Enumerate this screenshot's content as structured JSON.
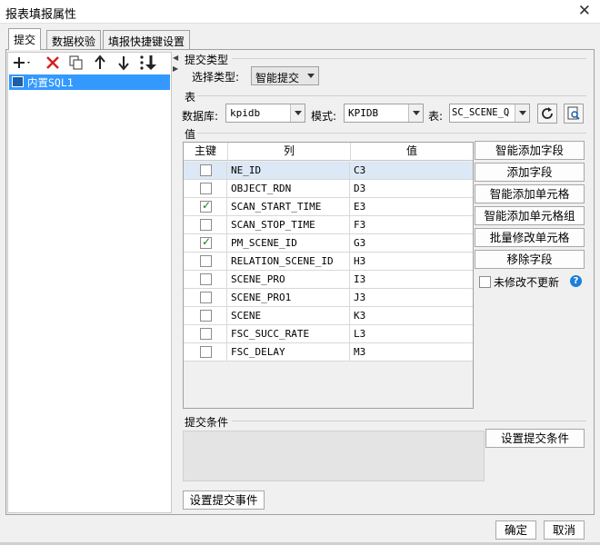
{
  "window": {
    "title": "报表填报属性",
    "close_glyph": "✕"
  },
  "tabs": [
    {
      "label": "提交",
      "active": true
    },
    {
      "label": "数据校验",
      "active": false
    },
    {
      "label": "填报快捷键设置",
      "active": false
    }
  ],
  "left_toolbar": {
    "icons": [
      "add-icon",
      "delete-icon",
      "copy-icon",
      "move-up-icon",
      "move-down-icon",
      "sort-icon"
    ]
  },
  "tree": {
    "items": [
      {
        "label": "内置SQL1",
        "selected": true
      }
    ]
  },
  "submit_type": {
    "section_label": "提交类型",
    "select_label": "选择类型:",
    "selected": "智能提交"
  },
  "table_section": {
    "section_label": "表",
    "database_label": "数据库:",
    "database_value": "kpidb",
    "schema_label": "模式:",
    "schema_value": "KPIDB",
    "table_label": "表:",
    "table_value": "SC_SCENE_Q"
  },
  "value_section": {
    "section_label": "值",
    "columns": [
      "主键",
      "列",
      "值"
    ],
    "rows": [
      {
        "key": false,
        "column": "NE_ID",
        "value": "C3",
        "selected": true
      },
      {
        "key": false,
        "column": "OBJECT_RDN",
        "value": "D3"
      },
      {
        "key": true,
        "column": "SCAN_START_TIME",
        "value": "E3"
      },
      {
        "key": false,
        "column": "SCAN_STOP_TIME",
        "value": "F3"
      },
      {
        "key": true,
        "column": "PM_SCENE_ID",
        "value": "G3"
      },
      {
        "key": false,
        "column": "RELATION_SCENE_ID",
        "value": "H3"
      },
      {
        "key": false,
        "column": "SCENE_PRO",
        "value": "I3"
      },
      {
        "key": false,
        "column": "SCENE_PRO1",
        "value": "J3"
      },
      {
        "key": false,
        "column": "SCENE",
        "value": "K3"
      },
      {
        "key": false,
        "column": "FSC_SUCC_RATE",
        "value": "L3"
      },
      {
        "key": false,
        "column": "FSC_DELAY",
        "value": "M3"
      }
    ]
  },
  "side_buttons": {
    "smart_add_field": "智能添加字段",
    "add_field": "添加字段",
    "smart_add_cell": "智能添加单元格",
    "smart_add_cell_group": "智能添加单元格组",
    "batch_modify_cell": "批量修改单元格",
    "remove_field": "移除字段",
    "no_update_unmodified": "未修改不更新",
    "help_glyph": "?"
  },
  "condition_section": {
    "section_label": "提交条件",
    "set_condition_button": "设置提交条件"
  },
  "set_event_button": "设置提交事件",
  "footer": {
    "ok": "确定",
    "cancel": "取消"
  }
}
